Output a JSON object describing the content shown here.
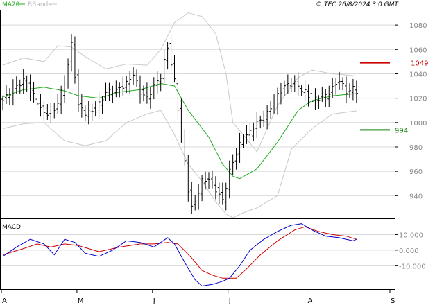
{
  "header": {
    "legend_ma": "MA20",
    "legend_bb": "BBands",
    "copyright": "© TEC 26/8/2024 3:0 GMT"
  },
  "colors": {
    "ma": "#22aa22",
    "bands": "#c8c8c8",
    "bars": "#000000",
    "resistance": "#cc0000",
    "support": "#118811",
    "macd": "#0000cc",
    "signal": "#cc0000",
    "grid": "#d8d8d8"
  },
  "chart_data": [
    {
      "type": "ohlc",
      "y_ticks": [
        940,
        960,
        980,
        1000,
        1020,
        1040,
        1060,
        1080
      ],
      "ylim": [
        922,
        1092
      ],
      "x_ticks": [
        "A",
        "M",
        "J",
        "J",
        "A",
        "S"
      ],
      "x_tick_index": [
        0,
        22,
        44,
        66,
        89,
        111
      ],
      "n_days": 104,
      "ma20_key": [
        [
          0,
          1021
        ],
        [
          6,
          1027
        ],
        [
          12,
          1029
        ],
        [
          18,
          1026
        ],
        [
          22,
          1022
        ],
        [
          28,
          1020
        ],
        [
          34,
          1025
        ],
        [
          40,
          1027
        ],
        [
          46,
          1032
        ],
        [
          50,
          1030
        ],
        [
          54,
          1010
        ],
        [
          60,
          988
        ],
        [
          64,
          966
        ],
        [
          67,
          956
        ],
        [
          69,
          954
        ],
        [
          74,
          962
        ],
        [
          80,
          984
        ],
        [
          86,
          1010
        ],
        [
          90,
          1018
        ],
        [
          96,
          1022
        ],
        [
          104,
          1024
        ]
      ],
      "bb_upper_key": [
        [
          0,
          1047
        ],
        [
          6,
          1053
        ],
        [
          12,
          1050
        ],
        [
          16,
          1063
        ],
        [
          20,
          1062
        ],
        [
          24,
          1054
        ],
        [
          30,
          1044
        ],
        [
          36,
          1048
        ],
        [
          42,
          1047
        ],
        [
          46,
          1060
        ],
        [
          50,
          1082
        ],
        [
          54,
          1090
        ],
        [
          58,
          1087
        ],
        [
          62,
          1073
        ],
        [
          65,
          1040
        ],
        [
          67,
          1000
        ],
        [
          70,
          990
        ],
        [
          74,
          976
        ],
        [
          80,
          1014
        ],
        [
          86,
          1037
        ],
        [
          90,
          1043
        ],
        [
          96,
          1040
        ],
        [
          104,
          1038
        ]
      ],
      "bb_lower_key": [
        [
          0,
          995
        ],
        [
          6,
          999
        ],
        [
          12,
          1000
        ],
        [
          18,
          985
        ],
        [
          24,
          981
        ],
        [
          30,
          985
        ],
        [
          36,
          1000
        ],
        [
          42,
          1007
        ],
        [
          46,
          1010
        ],
        [
          50,
          990
        ],
        [
          54,
          966
        ],
        [
          58,
          952
        ],
        [
          62,
          935
        ],
        [
          65,
          925
        ],
        [
          67,
          922
        ],
        [
          70,
          926
        ],
        [
          74,
          930
        ],
        [
          80,
          940
        ],
        [
          84,
          978
        ],
        [
          90,
          995
        ],
        [
          96,
          1007
        ],
        [
          104,
          1010
        ]
      ],
      "price_key": [
        [
          0,
          1018
        ],
        [
          3,
          1028
        ],
        [
          6,
          1034
        ],
        [
          9,
          1022
        ],
        [
          12,
          1007
        ],
        [
          15,
          1010
        ],
        [
          18,
          1032
        ],
        [
          20,
          1064
        ],
        [
          22,
          1014
        ],
        [
          24,
          1008
        ],
        [
          27,
          1010
        ],
        [
          30,
          1025
        ],
        [
          33,
          1026
        ],
        [
          36,
          1032
        ],
        [
          38,
          1040
        ],
        [
          40,
          1025
        ],
        [
          42,
          1020
        ],
        [
          44,
          1030
        ],
        [
          46,
          1038
        ],
        [
          48,
          1062
        ],
        [
          50,
          1034
        ],
        [
          52,
          990
        ],
        [
          54,
          945
        ],
        [
          55,
          930
        ],
        [
          56,
          935
        ],
        [
          58,
          952
        ],
        [
          60,
          954
        ],
        [
          62,
          945
        ],
        [
          64,
          936
        ],
        [
          66,
          960
        ],
        [
          68,
          975
        ],
        [
          70,
          988
        ],
        [
          72,
          992
        ],
        [
          74,
          1000
        ],
        [
          76,
          1003
        ],
        [
          78,
          1012
        ],
        [
          80,
          1022
        ],
        [
          82,
          1030
        ],
        [
          85,
          1032
        ],
        [
          88,
          1025
        ],
        [
          90,
          1018
        ],
        [
          92,
          1020
        ],
        [
          94,
          1022
        ],
        [
          96,
          1028
        ],
        [
          98,
          1035
        ],
        [
          100,
          1025
        ],
        [
          102,
          1028
        ],
        [
          103,
          1026
        ]
      ],
      "resistance": {
        "value": 1049,
        "label": "1049"
      },
      "support": {
        "value": 994,
        "label": "994"
      }
    },
    {
      "type": "line",
      "title": "MACD",
      "y_ticks": [
        -10,
        0,
        10
      ],
      "ylim": [
        -25,
        20
      ],
      "macd_key": [
        [
          0,
          -4
        ],
        [
          4,
          2
        ],
        [
          8,
          7
        ],
        [
          12,
          4
        ],
        [
          15,
          -3
        ],
        [
          18,
          7
        ],
        [
          21,
          5
        ],
        [
          24,
          -2
        ],
        [
          28,
          -4
        ],
        [
          32,
          0
        ],
        [
          36,
          6
        ],
        [
          40,
          5
        ],
        [
          44,
          2
        ],
        [
          48,
          8
        ],
        [
          50,
          4
        ],
        [
          53,
          -8
        ],
        [
          56,
          -19
        ],
        [
          58,
          -23
        ],
        [
          61,
          -22
        ],
        [
          64,
          -20
        ],
        [
          66,
          -18
        ],
        [
          69,
          -10
        ],
        [
          72,
          0
        ],
        [
          76,
          7
        ],
        [
          80,
          12
        ],
        [
          84,
          16
        ],
        [
          87,
          17
        ],
        [
          90,
          13
        ],
        [
          94,
          9
        ],
        [
          98,
          8
        ],
        [
          102,
          6
        ],
        [
          103,
          7
        ]
      ],
      "signal_key": [
        [
          0,
          -3
        ],
        [
          6,
          1
        ],
        [
          10,
          4
        ],
        [
          14,
          2
        ],
        [
          18,
          4
        ],
        [
          22,
          3
        ],
        [
          28,
          -1
        ],
        [
          34,
          2
        ],
        [
          40,
          4
        ],
        [
          44,
          4
        ],
        [
          48,
          5
        ],
        [
          51,
          4
        ],
        [
          55,
          -5
        ],
        [
          58,
          -13
        ],
        [
          61,
          -16
        ],
        [
          64,
          -18
        ],
        [
          68,
          -18
        ],
        [
          71,
          -12
        ],
        [
          75,
          -3
        ],
        [
          80,
          6
        ],
        [
          85,
          13
        ],
        [
          88,
          15
        ],
        [
          92,
          12
        ],
        [
          96,
          10
        ],
        [
          100,
          9
        ],
        [
          103,
          7
        ]
      ]
    }
  ]
}
